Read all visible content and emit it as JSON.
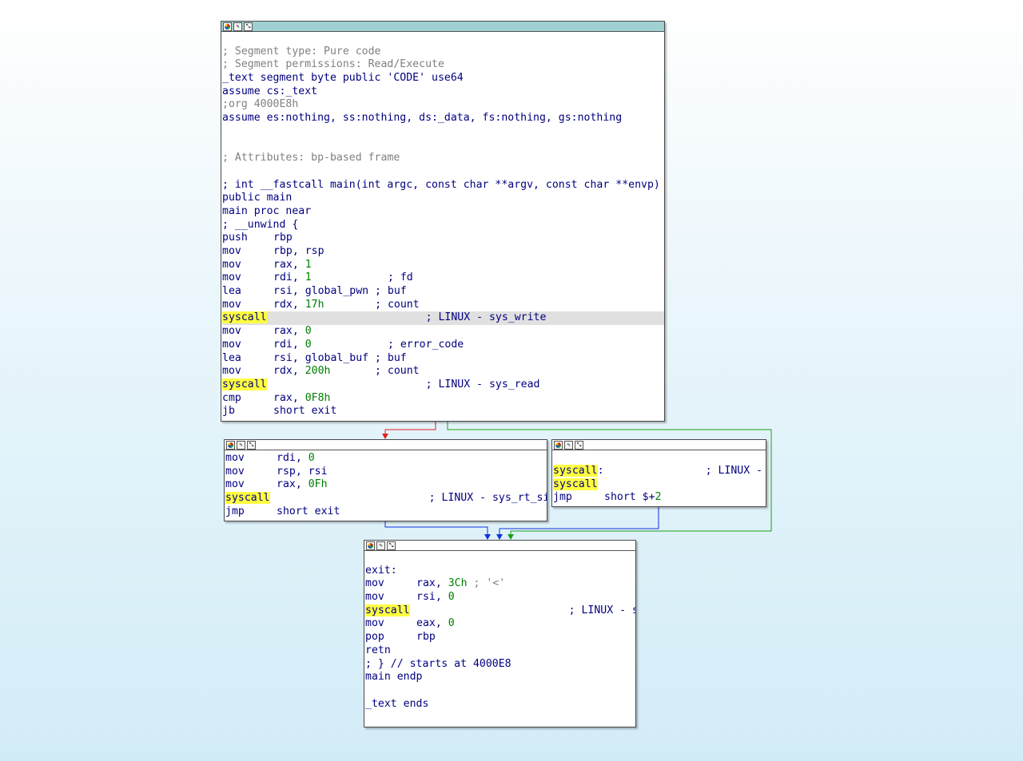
{
  "node_main": {
    "lines": [
      {
        "t": ""
      },
      {
        "t": "gc",
        "text": "; Segment type: Pure code"
      },
      {
        "t": "gc",
        "text": "; Segment permissions: Read/Execute"
      },
      {
        "t": "dir",
        "text": "_text segment byte public 'CODE' use64"
      },
      {
        "t": "dir",
        "text": "assume cs:_text"
      },
      {
        "t": "gc",
        "text": ";org 4000E8h"
      },
      {
        "t": "dir",
        "text": "assume es:nothing, ss:nothing, ds:_data, fs:nothing, gs:nothing"
      },
      {
        "t": ""
      },
      {
        "t": ""
      },
      {
        "t": "gc",
        "text": "; Attributes: bp-based frame"
      },
      {
        "t": ""
      },
      {
        "t": "dir",
        "text": "; int __fastcall main(int argc, const char **argv, const char **envp)"
      },
      {
        "t": "dir",
        "text": "public main"
      },
      {
        "t": "dir",
        "text": "main proc near"
      },
      {
        "t": "dir",
        "text": "; __unwind {"
      },
      {
        "t": "ins",
        "mn": "push",
        "op": "rbp",
        "num": "",
        "cm": ""
      },
      {
        "t": "ins",
        "mn": "mov",
        "op": "rbp, rsp",
        "num": "",
        "cm": ""
      },
      {
        "t": "ins",
        "mn": "mov",
        "op": "rax, ",
        "num": "1",
        "cm": ""
      },
      {
        "t": "ins",
        "mn": "mov",
        "op": "rdi, ",
        "num": "1",
        "cm": "; fd",
        "pad": 12
      },
      {
        "t": "ins",
        "mn": "lea",
        "op": "rsi, global_pwn",
        "num": "",
        "cm": "; buf",
        "pad": 1
      },
      {
        "t": "ins",
        "mn": "mov",
        "op": "rdx, ",
        "num": "17h",
        "cm": "; count",
        "pad": 8
      },
      {
        "t": "ins",
        "mn": "syscall",
        "sys": true,
        "op": "",
        "num": "",
        "cm": "; LINUX - sys_write",
        "pad": 24,
        "hl": true
      },
      {
        "t": "ins",
        "mn": "mov",
        "op": "rax, ",
        "num": "0",
        "cm": ""
      },
      {
        "t": "ins",
        "mn": "mov",
        "op": "rdi, ",
        "num": "0",
        "cm": "; error_code",
        "pad": 12
      },
      {
        "t": "ins",
        "mn": "lea",
        "op": "rsi, global_buf",
        "num": "",
        "cm": "; buf",
        "pad": 1
      },
      {
        "t": "ins",
        "mn": "mov",
        "op": "rdx, ",
        "num": "200h",
        "cm": "; count",
        "pad": 7
      },
      {
        "t": "ins",
        "mn": "syscall",
        "sys": true,
        "op": "",
        "num": "",
        "cm": "; LINUX - sys_read",
        "pad": 24
      },
      {
        "t": "ins",
        "mn": "cmp",
        "op": "rax, ",
        "num": "0F8h",
        "cm": ""
      },
      {
        "t": "ins",
        "mn": "jb",
        "op": "short exit",
        "num": "",
        "cm": ""
      }
    ]
  },
  "node_sigret": {
    "lines": [
      {
        "t": "ins",
        "mn": "mov",
        "op": "rdi, ",
        "num": "0",
        "cm": ""
      },
      {
        "t": "ins",
        "mn": "mov",
        "op": "rsp, rsi",
        "num": "",
        "cm": ""
      },
      {
        "t": "ins",
        "mn": "mov",
        "op": "rax, ",
        "num": "0Fh",
        "cm": ""
      },
      {
        "t": "ins",
        "mn": "syscall",
        "sys": true,
        "op": "",
        "num": "",
        "cm": "; LINUX - sys_rt_sigreturn",
        "pad": 24
      },
      {
        "t": "ins",
        "mn": "jmp",
        "op": "short exit",
        "num": "",
        "cm": ""
      }
    ]
  },
  "node_right": {
    "lines": [
      {
        "t": "lbl",
        "mn": "syscall",
        "sys": true,
        "after": ":",
        "cm": "; LINUX -",
        "pad": 16
      },
      {
        "t": "ins",
        "mn": "syscall",
        "sys": true,
        "op": "",
        "num": "",
        "cm": ""
      },
      {
        "t": "ins",
        "mn": "jmp",
        "op": "short $+",
        "num": "2",
        "cm": ""
      }
    ]
  },
  "node_exit": {
    "lines": [
      {
        "t": ""
      },
      {
        "t": "dir",
        "text": "exit:"
      },
      {
        "t": "ins",
        "mn": "mov",
        "op": "rax, ",
        "num": "3Ch",
        "gcm": "; '<'",
        "cm": "",
        "pad": 1
      },
      {
        "t": "ins",
        "mn": "mov",
        "op": "rsi, ",
        "num": "0",
        "cm": ""
      },
      {
        "t": "ins",
        "mn": "syscall",
        "sys": true,
        "op": "",
        "num": "",
        "cm": "; LINUX - sys_exit",
        "pad": 24
      },
      {
        "t": "ins",
        "mn": "mov",
        "op": "eax, ",
        "num": "0",
        "cm": ""
      },
      {
        "t": "ins",
        "mn": "pop",
        "op": "rbp",
        "num": "",
        "cm": ""
      },
      {
        "t": "ins",
        "mn": "retn",
        "op": "",
        "num": "",
        "cm": ""
      },
      {
        "t": "dir",
        "text": "; } // starts at 4000E8"
      },
      {
        "t": "dir",
        "text": "main endp"
      },
      {
        "t": ""
      },
      {
        "t": "dir",
        "text": "_text ends"
      }
    ]
  },
  "colors": {
    "edge_false": "#e02020",
    "edge_true": "#18a018",
    "edge_uncond": "#1030e0"
  }
}
